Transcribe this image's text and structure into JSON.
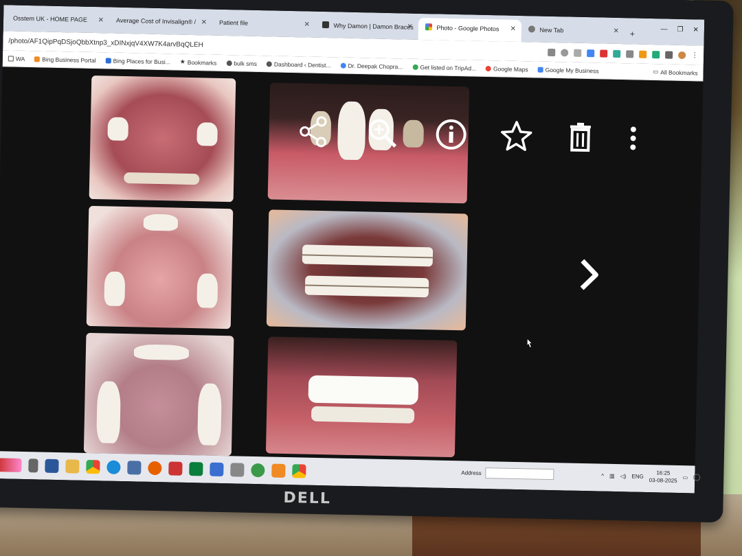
{
  "browser": {
    "tabs": [
      {
        "label": "Osstem UK - HOME PAGE",
        "active": false
      },
      {
        "label": "Average Cost of Invisalign® /",
        "active": false
      },
      {
        "label": "Patient file",
        "active": false
      },
      {
        "label": "Why Damon | Damon Braces",
        "active": false
      },
      {
        "label": "Photo - Google Photos",
        "active": true
      },
      {
        "label": "New Tab",
        "active": false
      }
    ],
    "url": "/photo/AF1QipPqDSjoQbbXtnp3_xDINxjqV4XW7K4arvBqQLEH",
    "bookmarks": [
      {
        "label": "WA",
        "color": "#555555"
      },
      {
        "label": "Bing Business Portal",
        "color": "#f08a24"
      },
      {
        "label": "Bing Places for Busi...",
        "color": "#2b6fd6"
      },
      {
        "label": "Bookmarks",
        "color": "#555555"
      },
      {
        "label": "bulk sms",
        "color": "#555555"
      },
      {
        "label": "Dashboard ‹ Dentist...",
        "color": "#555555"
      },
      {
        "label": "Dr. Deepak Chopra...",
        "color": "#4285f4"
      },
      {
        "label": "Get listed on TripAd...",
        "color": "#34a853"
      },
      {
        "label": "Google Maps",
        "color": "#ea4335"
      },
      {
        "label": "Google My Business",
        "color": "#4285f4"
      }
    ],
    "all_bookmarks": "All Bookmarks"
  },
  "viewer": {
    "icons": [
      "share-icon",
      "zoom-in-icon",
      "info-icon",
      "star-icon",
      "delete-icon",
      "more-icon"
    ],
    "next_icon": "chevron-right-icon"
  },
  "taskbar": {
    "address_label": "Address",
    "language": "ENG",
    "time": "16:25",
    "date": "03-08-2025"
  },
  "monitor": {
    "brand": "DELL"
  }
}
